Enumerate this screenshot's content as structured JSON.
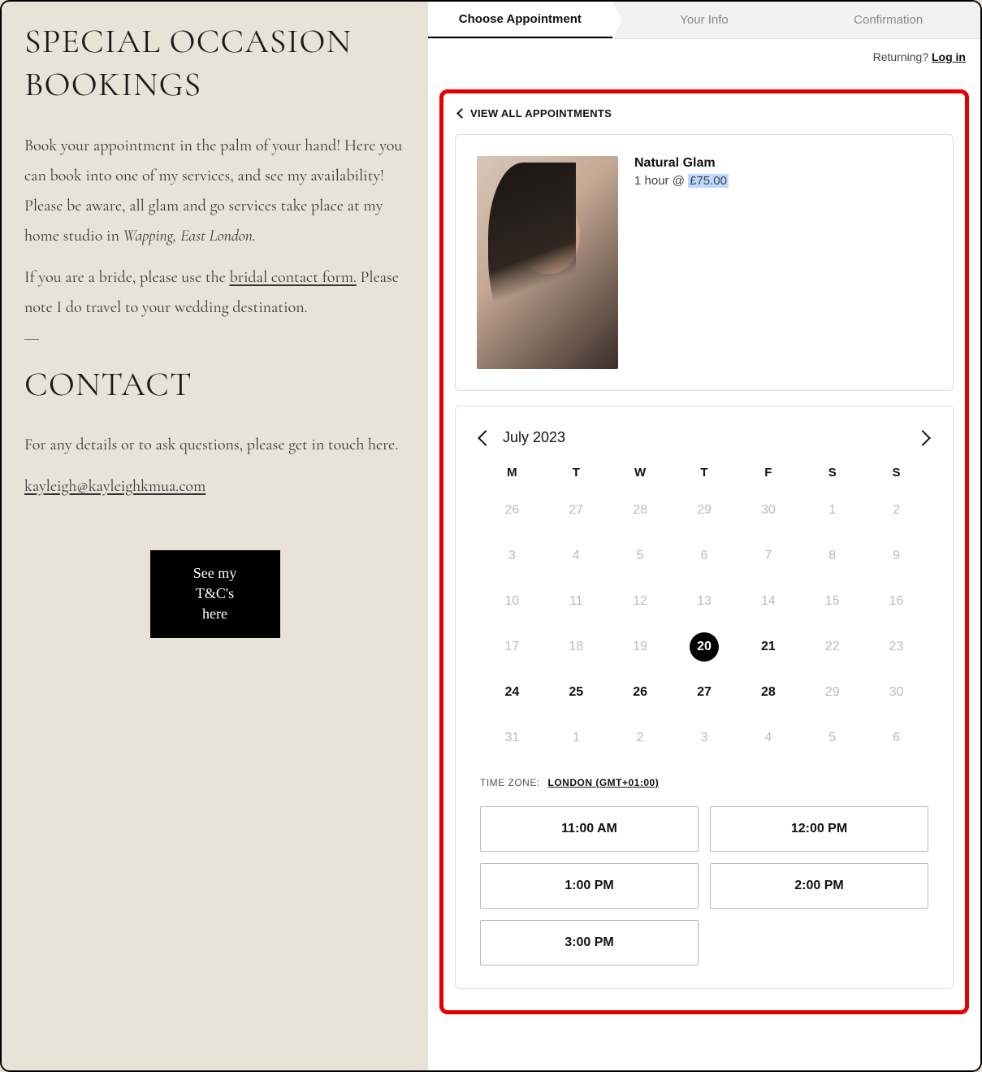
{
  "left": {
    "heading": "SPECIAL OCCASION BOOKINGS",
    "p1a": "Book your appointment in the palm of your hand! Here you can book into one of my services, and see my availability! Please be aware, all glam and go services take place at my home studio in ",
    "p1b": "Wapping, East London.",
    "p2a": "If you are a bride, please use the ",
    "bridal_link": "bridal contact form.",
    "p2b": " Please note I do travel to your wedding destination.",
    "contact_heading": "CONTACT",
    "contact_body": "For any details or to ask questions, please get in touch here.",
    "email": "kayleigh@kayleighkmua.com",
    "tc_button_l1": "See my T&C's",
    "tc_button_l2": "here"
  },
  "stepper": {
    "step1": "Choose Appointment",
    "step2": "Your Info",
    "step3": "Confirmation"
  },
  "returning_label": "Returning?",
  "login_label": "Log in",
  "view_all_label": "VIEW ALL APPOINTMENTS",
  "service": {
    "name": "Natural Glam",
    "duration": "1 hour @ ",
    "price": "£75.00"
  },
  "calendar": {
    "month_label": "July 2023",
    "dow": [
      "M",
      "T",
      "W",
      "T",
      "F",
      "S",
      "S"
    ],
    "weeks": [
      [
        {
          "n": "26"
        },
        {
          "n": "27"
        },
        {
          "n": "28"
        },
        {
          "n": "29"
        },
        {
          "n": "30"
        },
        {
          "n": "1"
        },
        {
          "n": "2"
        }
      ],
      [
        {
          "n": "3"
        },
        {
          "n": "4"
        },
        {
          "n": "5"
        },
        {
          "n": "6"
        },
        {
          "n": "7"
        },
        {
          "n": "8"
        },
        {
          "n": "9"
        }
      ],
      [
        {
          "n": "10"
        },
        {
          "n": "11"
        },
        {
          "n": "12"
        },
        {
          "n": "13"
        },
        {
          "n": "14"
        },
        {
          "n": "15"
        },
        {
          "n": "16"
        }
      ],
      [
        {
          "n": "17"
        },
        {
          "n": "18"
        },
        {
          "n": "19"
        },
        {
          "n": "20",
          "sel": true
        },
        {
          "n": "21",
          "a": true
        },
        {
          "n": "22"
        },
        {
          "n": "23"
        }
      ],
      [
        {
          "n": "24",
          "a": true
        },
        {
          "n": "25",
          "a": true
        },
        {
          "n": "26",
          "a": true
        },
        {
          "n": "27",
          "a": true
        },
        {
          "n": "28",
          "a": true
        },
        {
          "n": "29"
        },
        {
          "n": "30"
        }
      ],
      [
        {
          "n": "31"
        },
        {
          "n": "1"
        },
        {
          "n": "2"
        },
        {
          "n": "3"
        },
        {
          "n": "4"
        },
        {
          "n": "5"
        },
        {
          "n": "6"
        }
      ]
    ],
    "tz_label": "TIME ZONE:",
    "tz_value": "LONDON (GMT+01:00)"
  },
  "slots": [
    "11:00 AM",
    "12:00 PM",
    "1:00 PM",
    "2:00 PM",
    "3:00 PM"
  ]
}
